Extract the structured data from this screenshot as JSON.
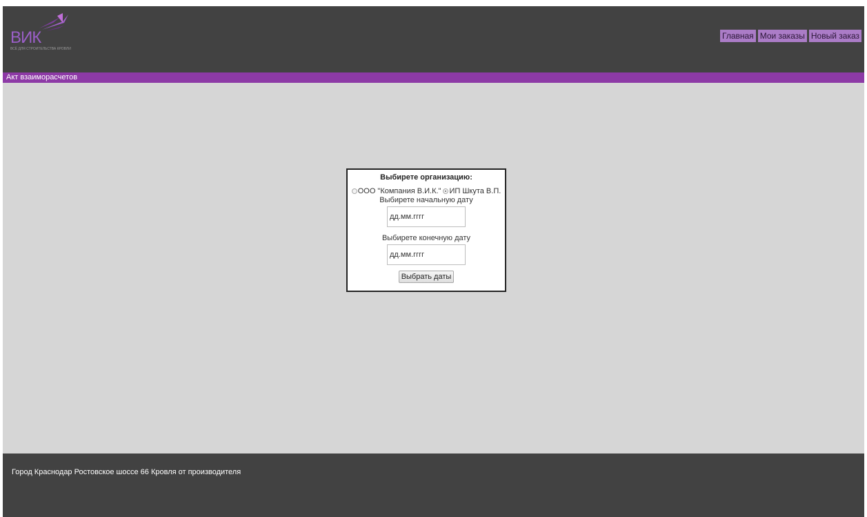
{
  "header": {
    "logo_text": "ВИК",
    "logo_tagline": "ВСЁ ДЛЯ СТРОИТЕЛЬСТВА КРОВЛИ",
    "nav": [
      {
        "label": "Главная"
      },
      {
        "label": "Мои заказы"
      },
      {
        "label": "Новый заказ"
      }
    ]
  },
  "title_bar": {
    "label": "Акт взаиморасчетов"
  },
  "form": {
    "heading": "Выбирете организацию:",
    "org_options": [
      {
        "label": "ООО \"Компания В.И.К.\"",
        "checked": false
      },
      {
        "label": "ИП Шкута В.П.",
        "checked": true
      }
    ],
    "start_date_label": "Выбирете начальную дату",
    "start_date_placeholder": "дд.мм.гггг",
    "end_date_label": "Выбирете конечную дату",
    "end_date_placeholder": "дд.мм.гггг",
    "submit_label": "Выбрать даты"
  },
  "footer": {
    "text": "Город Краснодар Ростовское шоссе 66 Кровля от производителя"
  },
  "colors": {
    "header_bg": "#424242",
    "accent": "#8d3aa6",
    "nav_bg": "#ab7cc7",
    "content_bg": "#d6d6d6"
  }
}
